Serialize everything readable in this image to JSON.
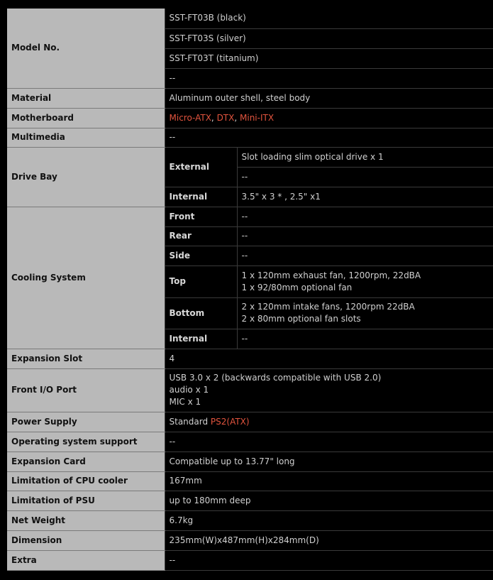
{
  "model_no": {
    "label": "Model No.",
    "values": [
      "SST-FT03B (black)",
      "SST-FT03S (silver)",
      "SST-FT03T (titanium)",
      "--"
    ]
  },
  "material": {
    "label": "Material",
    "value": "Aluminum outer shell, steel body"
  },
  "motherboard": {
    "label": "Motherboard",
    "links": [
      "Micro-ATX",
      "DTX",
      "Mini-ITX"
    ],
    "sep": ", "
  },
  "multimedia": {
    "label": "Multimedia",
    "value": "--"
  },
  "drive_bay": {
    "label": "Drive Bay",
    "external_label": "External",
    "external_values": [
      "Slot loading slim optical drive x 1",
      "--"
    ],
    "internal_label": "Internal",
    "internal_value": "3.5\" x 3 * , 2.5\" x1"
  },
  "cooling": {
    "label": "Cooling System",
    "front_label": "Front",
    "front_value": "--",
    "rear_label": "Rear",
    "rear_value": "--",
    "side_label": "Side",
    "side_value": "--",
    "top_label": "Top",
    "top_values": [
      "1 x 120mm exhaust fan, 1200rpm, 22dBA",
      "1 x 92/80mm optional fan"
    ],
    "bottom_label": "Bottom",
    "bottom_values": [
      "2 x 120mm intake fans, 1200rpm 22dBA",
      "2 x 80mm optional fan slots"
    ],
    "internal_label": "Internal",
    "internal_value": "--"
  },
  "expansion_slot": {
    "label": "Expansion Slot",
    "value": "4"
  },
  "front_io": {
    "label": "Front I/O Port",
    "values": [
      "USB 3.0 x 2 (backwards compatible with USB 2.0)",
      "audio x 1",
      "MIC x 1"
    ]
  },
  "power_supply": {
    "label": "Power Supply",
    "prefix": "Standard ",
    "link": "PS2(ATX)"
  },
  "os_support": {
    "label": "Operating system support",
    "value": "--"
  },
  "expansion_card": {
    "label": "Expansion Card",
    "value": "Compatible up to 13.77\" long"
  },
  "cpu_cooler": {
    "label": "Limitation of CPU cooler",
    "value": "167mm"
  },
  "psu": {
    "label": "Limitation of PSU",
    "value": "up to 180mm deep"
  },
  "net_weight": {
    "label": "Net Weight",
    "value": "6.7kg"
  },
  "dimension": {
    "label": "Dimension",
    "value": "235mm(W)x487mm(H)x284mm(D)"
  },
  "extra": {
    "label": "Extra",
    "value": "--"
  },
  "colors": {
    "label_bg": "#b9b9b9",
    "accent": "#e2543e",
    "background": "#000000"
  }
}
